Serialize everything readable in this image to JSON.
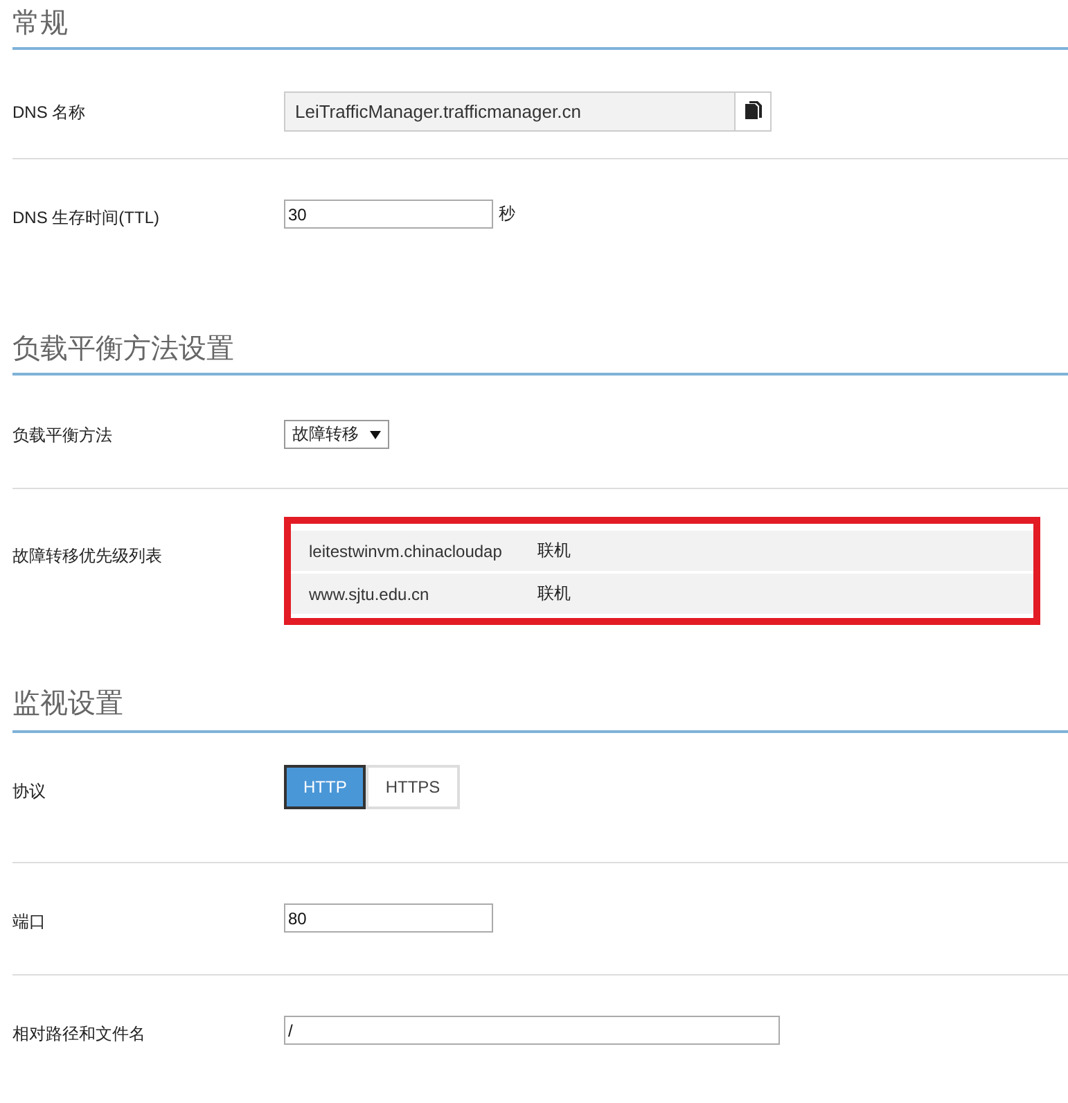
{
  "sections": [
    {
      "title": "常规",
      "rows": [
        {
          "kind": "readonly-copy",
          "label": "DNS 名称",
          "value": "LeiTrafficManager.trafficmanager.cn"
        },
        {
          "kind": "text",
          "label": "DNS 生存时间(TTL)",
          "value": "30",
          "unit": "秒"
        }
      ]
    },
    {
      "title": "负载平衡方法设置",
      "rows": [
        {
          "kind": "select",
          "label": "负载平衡方法",
          "value": "故障转移"
        },
        {
          "kind": "priority-list",
          "label": "故障转移优先级列表",
          "highlighted": true,
          "items": [
            {
              "endpoint": "leitestwinvm.chinacloudap",
              "status": "联机"
            },
            {
              "endpoint": "www.sjtu.edu.cn",
              "status": "联机"
            }
          ]
        }
      ]
    },
    {
      "title": "监视设置",
      "rows": [
        {
          "kind": "toggle",
          "label": "协议",
          "options": [
            {
              "label": "HTTP",
              "selected": true
            },
            {
              "label": "HTTPS",
              "selected": false
            }
          ]
        },
        {
          "kind": "text",
          "label": "端口",
          "value": "80"
        },
        {
          "kind": "wide-text",
          "label": "相对路径和文件名",
          "value": "/"
        }
      ]
    }
  ]
}
